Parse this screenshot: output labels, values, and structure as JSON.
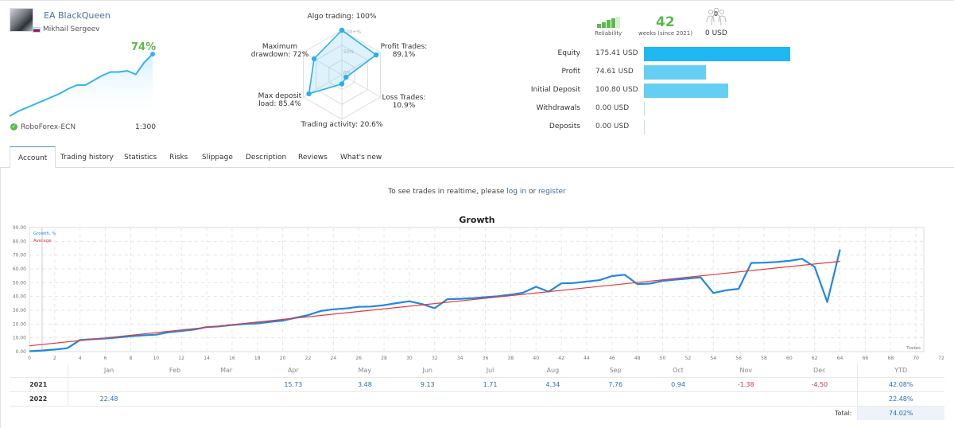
{
  "signal": {
    "name": "EA BlackQueen",
    "author": "Mikhail Sergeev",
    "author_country_icon": "flag-russia-icon",
    "growth_percent": "74%",
    "broker": "RoboForex-ECN",
    "broker_icon": "verified-shield-icon",
    "leverage": "1:300",
    "sparkline": [
      0,
      4,
      7,
      10,
      13,
      16,
      19,
      23,
      26,
      26,
      30,
      34,
      37,
      37,
      38,
      35,
      45,
      52
    ]
  },
  "radar": {
    "axes": [
      {
        "label": "Algo trading: 100%",
        "value": 100
      },
      {
        "label": "Profit Trades:\n89.1%",
        "value": 89.1
      },
      {
        "label": "Loss Trades:\n10.9%",
        "value": 10.9
      },
      {
        "label": "Trading activity: 20.6%",
        "value": 20.6
      },
      {
        "label": "Max deposit\nload: 85.4%",
        "value": 85.4
      },
      {
        "label": "Maximum\ndrawdown: 72%",
        "value": 72
      }
    ],
    "ring_labels": [
      "100+%",
      "50%",
      "0%"
    ]
  },
  "stats": {
    "reliability_label": "Reliability",
    "reliability_level": 4,
    "reliability_max": 5,
    "weeks": "42",
    "weeks_label": "weeks (since 2021)",
    "subscribers": "0",
    "subscribers_usd": "0 USD",
    "colors": {
      "green": "#5cb94c",
      "bar_dark": "#1fb8f0",
      "bar_light": "#64cff2"
    }
  },
  "balance": [
    {
      "label": "Equity",
      "value": "175.41 USD",
      "amount": 175.41
    },
    {
      "label": "Profit",
      "value": "74.61 USD",
      "amount": 74.61
    },
    {
      "label": "Initial Deposit",
      "value": "100.80 USD",
      "amount": 100.8
    },
    {
      "label": "Withdrawals",
      "value": "0.00 USD",
      "amount": 0
    },
    {
      "label": "Deposits",
      "value": "0.00 USD",
      "amount": 0
    }
  ],
  "tabs": [
    {
      "label": "Account",
      "active": true
    },
    {
      "label": "Trading history",
      "active": false
    },
    {
      "label": "Statistics",
      "active": false
    },
    {
      "label": "Risks",
      "active": false
    },
    {
      "label": "Slippage",
      "active": false
    },
    {
      "label": "Description",
      "active": false
    },
    {
      "label": "Reviews",
      "active": false
    },
    {
      "label": "What's new",
      "active": false
    }
  ],
  "realtime": {
    "prefix": "To see trades in realtime, please ",
    "login": "log in",
    "middle": " or ",
    "register": "register"
  },
  "chart_data": {
    "type": "line",
    "title": "Growth",
    "xlabel": "Trades",
    "ylabel": "",
    "xlim": [
      0,
      72
    ],
    "ylim": [
      0,
      90
    ],
    "xticks": [
      0,
      2,
      4,
      6,
      8,
      10,
      12,
      14,
      16,
      18,
      20,
      22,
      24,
      26,
      28,
      30,
      32,
      34,
      36,
      38,
      40,
      42,
      44,
      46,
      48,
      50,
      52,
      54,
      56,
      58,
      60,
      62,
      64,
      66,
      68,
      70,
      72
    ],
    "yticks": [
      "0.00",
      "10.00",
      "20.00",
      "30.00",
      "40.00",
      "50.00",
      "60.00",
      "70.00",
      "80.00",
      "90.00"
    ],
    "grid": true,
    "legend_position": "top-left",
    "series": [
      {
        "name": "Growth, %",
        "color": "#1e88e5",
        "x": [
          0,
          1,
          2,
          3,
          4,
          5,
          6,
          7,
          8,
          9,
          10,
          11,
          12,
          13,
          14,
          15,
          16,
          17,
          18,
          19,
          20,
          21,
          22,
          23,
          24,
          25,
          26,
          27,
          28,
          29,
          30,
          31,
          32,
          33,
          34,
          35,
          36,
          37,
          38,
          39,
          40,
          41,
          42,
          43,
          44,
          45,
          46,
          47,
          48,
          49,
          50,
          51,
          52,
          53,
          54,
          55,
          56,
          57,
          58,
          59,
          60,
          61,
          62,
          63,
          64
        ],
        "values": [
          0.3,
          0.8,
          1.5,
          2.5,
          8.5,
          9.0,
          9.5,
          10.3,
          11.2,
          11.8,
          12.3,
          14.0,
          15.0,
          16.0,
          17.8,
          18.3,
          19.3,
          20.0,
          20.5,
          21.5,
          22.5,
          24.5,
          26.5,
          29.5,
          30.7,
          31.3,
          32.5,
          32.7,
          33.7,
          35.2,
          36.5,
          34.5,
          31.5,
          38.0,
          38.3,
          38.7,
          39.5,
          40.2,
          41.3,
          42.8,
          47.0,
          43.5,
          49.5,
          49.8,
          50.8,
          51.8,
          54.8,
          55.8,
          49.0,
          49.3,
          51.3,
          52.2,
          53.0,
          53.8,
          42.5,
          44.5,
          45.5,
          64.3,
          64.5,
          65.0,
          65.8,
          67.3,
          61.5,
          36.0,
          74.0
        ]
      },
      {
        "name": "Average",
        "color": "#e53935",
        "x": [
          0,
          64
        ],
        "values": [
          4.2,
          65.5
        ]
      }
    ]
  },
  "monthly": {
    "months": [
      "Jan",
      "Feb",
      "Mar",
      "Apr",
      "May",
      "Jun",
      "Jul",
      "Aug",
      "Sep",
      "Oct",
      "Nov",
      "Dec"
    ],
    "ytd_label": "YTD",
    "rows": [
      {
        "year": "2021",
        "values": [
          "",
          "",
          "",
          "15.73",
          "3.48",
          "9.13",
          "1.71",
          "4.34",
          "7.76",
          "0.94",
          "-1.38",
          "-4.50"
        ],
        "ytd": "42.08%"
      },
      {
        "year": "2022",
        "values": [
          "22.48",
          "",
          "",
          "",
          "",
          "",
          "",
          "",
          "",
          "",
          "",
          ""
        ],
        "ytd": "22.48%"
      }
    ],
    "total_label": "Total:",
    "total_value": "74.02%"
  }
}
